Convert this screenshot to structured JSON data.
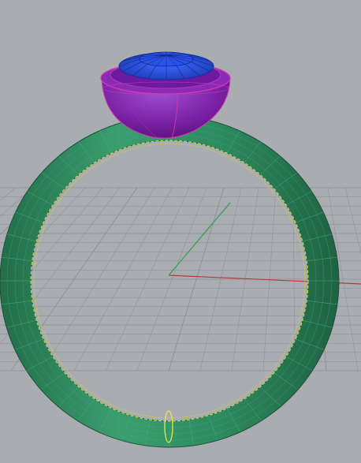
{
  "viewport": {
    "background_color": "#a9acb1",
    "grid_color": "#8f9296",
    "grid_major_color": "#7f8286",
    "x_axis_color": "#b43a3a",
    "y_axis_color": "#2fa24a"
  },
  "model": {
    "ring_band_color": "#2f8a5e",
    "ring_highlight_color": "#3fb07a",
    "ring_wire_color": "#b9e04a",
    "setting_color": "#7a1ea0",
    "setting_highlight_color": "#9b3fc5",
    "setting_edge_color": "#d43ab0",
    "gem_color": "#1e40c8",
    "gem_highlight_color": "#3a66ff",
    "seam_color": "#e8e35a"
  }
}
